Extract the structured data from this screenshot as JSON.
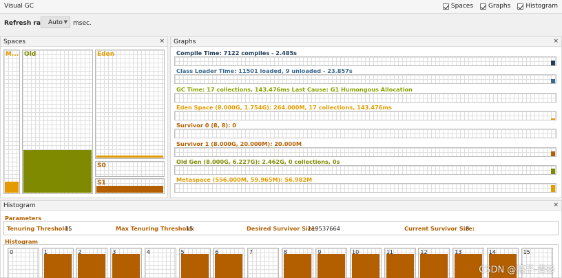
{
  "window": {
    "title": "Visual GC"
  },
  "toggles": [
    {
      "label": "Spaces",
      "checked": true
    },
    {
      "label": "Graphs",
      "checked": true
    },
    {
      "label": "Histogram",
      "checked": true
    }
  ],
  "refresh": {
    "label": "Refresh rate:",
    "value": "Auto",
    "unit": "msec."
  },
  "spaces": {
    "title": "Spaces",
    "close": "×",
    "items": [
      {
        "label": "M...",
        "fill": 0.08,
        "color": "#e39b00"
      },
      {
        "label": "Old",
        "fill": 0.3,
        "color": "#7f8a00"
      },
      {
        "label": "Eden",
        "fill": 0.02,
        "color": "#e39b00"
      },
      {
        "label": "S0",
        "fill": 0.0,
        "color": "#b35f00"
      },
      {
        "label": "S1",
        "fill": 0.55,
        "color": "#b35f00"
      }
    ]
  },
  "graphs": {
    "title": "Graphs",
    "close": "×",
    "items": [
      {
        "label": "Compile Time: 7122 compiles - 2.485s",
        "color": "#1f3b57",
        "level": 0.6
      },
      {
        "label": "Class Loader Time: 11501 loaded, 9 unloaded - 23.857s",
        "color": "#3b6a8f",
        "level": 0.5
      },
      {
        "label": "GC Time: 17 collections, 143.476ms Last Cause: G1 Humongous Allocation",
        "color": "#8aa300",
        "level": 0.0
      },
      {
        "label": "Eden Space (8.000G, 1.754G): 264.000M, 17 collections, 143.476ms",
        "color": "#e39b00",
        "level": 0.15
      },
      {
        "label": "Survivor 0 (8, 8): 0",
        "color": "#b35f00",
        "level": 0.0
      },
      {
        "label": "Survivor 1 (8.000G, 20.000M): 20.000M",
        "color": "#b35f00",
        "level": 0.6
      },
      {
        "label": "Old Gen (8.000G, 6.227G): 2.462G, 0 collections, 0s",
        "color": "#7f8a00",
        "level": 0.7
      },
      {
        "label": "Metaspace (556.000M, 59.965M): 56.982M",
        "color": "#e39b00",
        "level": 0.85
      }
    ]
  },
  "histogram": {
    "title": "Histogram",
    "close": "×",
    "params_title": "Parameters",
    "params": [
      {
        "label": "Tenuring Threshold:",
        "value": "15"
      },
      {
        "label": "Max Tenuring Threshold:",
        "value": "15"
      },
      {
        "label": "Desired Survivor Size:",
        "value": "119537664"
      },
      {
        "label": "Current Survivor Size:",
        "value": "8"
      }
    ],
    "hist_title": "Histogram",
    "bins": [
      {
        "label": "0",
        "fill": 0.0
      },
      {
        "label": "1",
        "fill": 0.92
      },
      {
        "label": "2",
        "fill": 0.92
      },
      {
        "label": "3",
        "fill": 0.92
      },
      {
        "label": "4",
        "fill": 0.0
      },
      {
        "label": "5",
        "fill": 0.92
      },
      {
        "label": "6",
        "fill": 0.92
      },
      {
        "label": "7",
        "fill": 0.0
      },
      {
        "label": "8",
        "fill": 0.92
      },
      {
        "label": "9",
        "fill": 0.92
      },
      {
        "label": "10",
        "fill": 0.92
      },
      {
        "label": "11",
        "fill": 0.92
      },
      {
        "label": "12",
        "fill": 0.92
      },
      {
        "label": "13",
        "fill": 0.92
      },
      {
        "label": "14",
        "fill": 0.92
      },
      {
        "label": "15",
        "fill": 0.0
      }
    ]
  },
  "watermark": {
    "text": "CSDN @橘子-青衫"
  }
}
